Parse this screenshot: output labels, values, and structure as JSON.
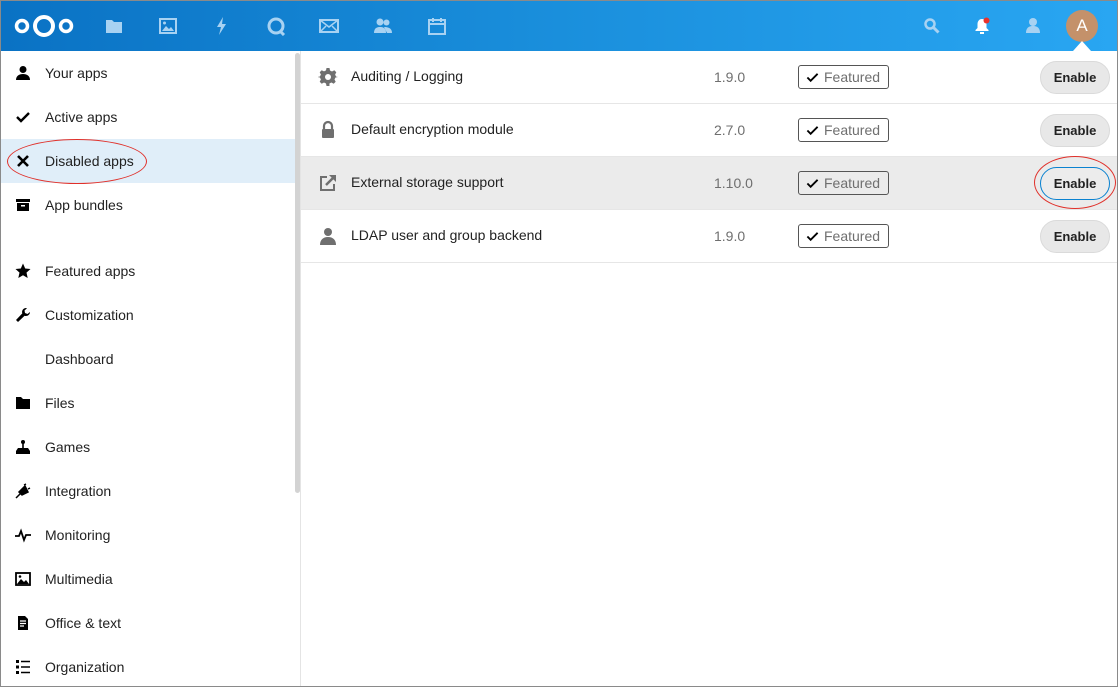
{
  "header": {
    "logo": "nextcloud-logo",
    "nav_icons": [
      "files-icon",
      "photos-icon",
      "activity-icon",
      "talk-icon",
      "mail-icon",
      "contacts-icon",
      "calendar-icon"
    ],
    "right_icons": [
      "search-icon",
      "notifications-icon",
      "contacts-menu-icon"
    ],
    "notification_dot_color": "#e9322d",
    "avatar_initial": "A",
    "avatar_color": "#c4916a",
    "brand_color": "#0082c9"
  },
  "sidebar": {
    "items": [
      {
        "label": "Your apps",
        "icon": "user-icon"
      },
      {
        "label": "Active apps",
        "icon": "checkmark-icon"
      },
      {
        "label": "Disabled apps",
        "icon": "close-icon",
        "active": true
      },
      {
        "label": "App bundles",
        "icon": "archive-icon"
      },
      {
        "label": "Featured apps",
        "icon": "star-icon"
      },
      {
        "label": "Customization",
        "icon": "wrench-icon"
      },
      {
        "label": "Dashboard",
        "icon": ""
      },
      {
        "label": "Files",
        "icon": "folder-icon"
      },
      {
        "label": "Games",
        "icon": "joystick-icon"
      },
      {
        "label": "Integration",
        "icon": "plug-icon"
      },
      {
        "label": "Monitoring",
        "icon": "pulse-icon"
      },
      {
        "label": "Multimedia",
        "icon": "image-icon"
      },
      {
        "label": "Office & text",
        "icon": "document-icon"
      },
      {
        "label": "Organization",
        "icon": "list-icon"
      }
    ]
  },
  "apps": [
    {
      "name": "Auditing / Logging",
      "icon": "gear-icon",
      "version": "1.9.0",
      "badge": "Featured",
      "action": "Enable"
    },
    {
      "name": "Default encryption module",
      "icon": "lock-icon",
      "version": "2.7.0",
      "badge": "Featured",
      "action": "Enable"
    },
    {
      "name": "External storage support",
      "icon": "external-link-icon",
      "version": "1.10.0",
      "badge": "Featured",
      "action": "Enable",
      "hovered": true
    },
    {
      "name": "LDAP user and group backend",
      "icon": "user-icon",
      "version": "1.9.0",
      "badge": "Featured",
      "action": "Enable"
    }
  ],
  "annotations": {
    "highlight_color": "#e0302a"
  }
}
